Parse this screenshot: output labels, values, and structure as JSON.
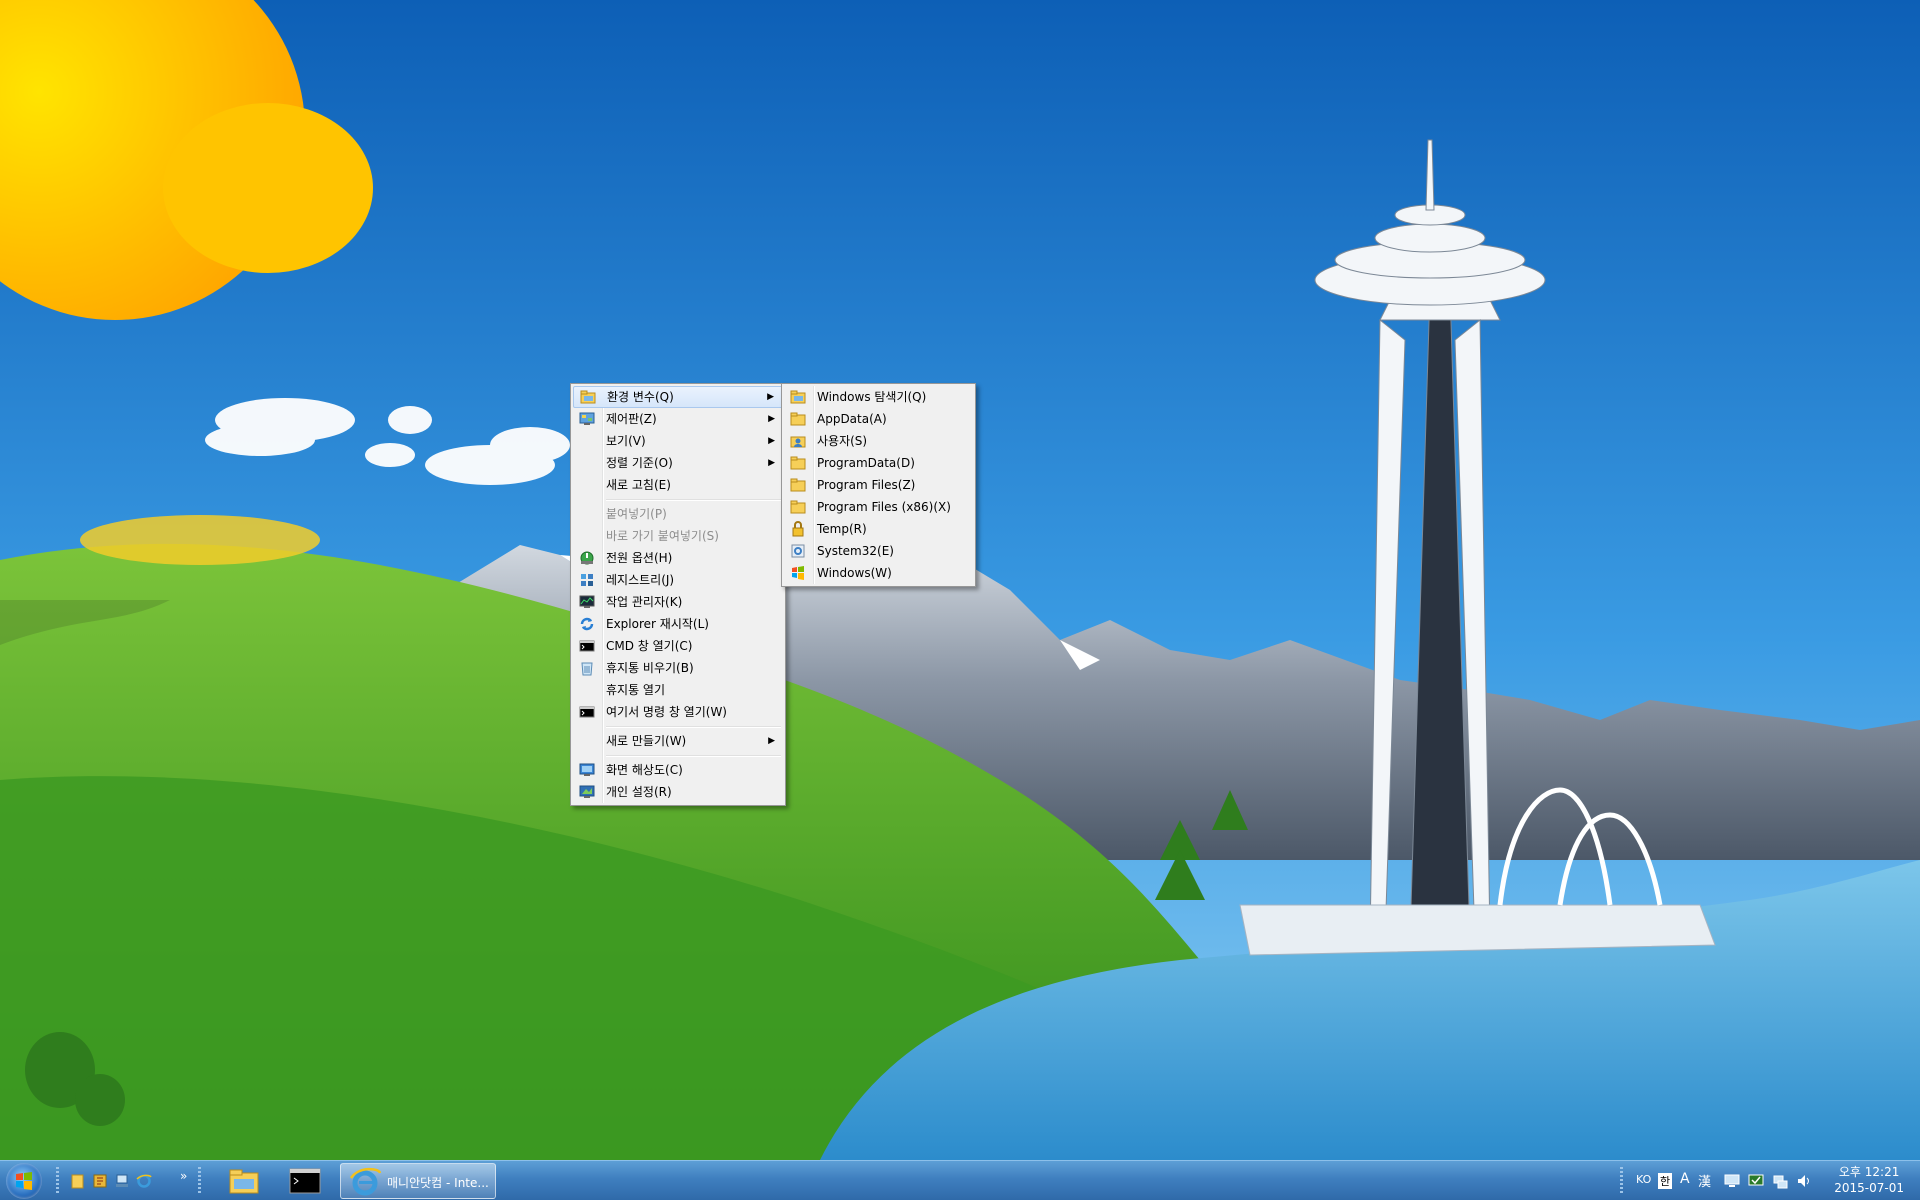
{
  "context_menu": {
    "items": [
      {
        "label": "환경 변수(Q)",
        "icon": "folder-tree-icon",
        "submenu": true,
        "highlight": true
      },
      {
        "label": "제어판(Z)",
        "icon": "control-panel-icon",
        "submenu": true
      },
      {
        "label": "보기(V)",
        "submenu": true
      },
      {
        "label": "정렬 기준(O)",
        "submenu": true
      },
      {
        "label": "새로 고침(E)"
      },
      {
        "label": "붙여넣기(P)",
        "disabled": true
      },
      {
        "label": "바로 가기 붙여넣기(S)",
        "disabled": true
      },
      {
        "label": "전원 옵션(H)",
        "icon": "power-options-icon"
      },
      {
        "label": "레지스트리(J)",
        "icon": "registry-icon"
      },
      {
        "label": "작업 관리자(K)",
        "icon": "task-manager-icon"
      },
      {
        "label": "Explorer 재시작(L)",
        "icon": "restart-icon"
      },
      {
        "label": "CMD 창 열기(C)",
        "icon": "cmd-icon"
      },
      {
        "label": "휴지통 비우기(B)",
        "icon": "recycle-bin-icon"
      },
      {
        "label": "휴지통 열기"
      },
      {
        "label": "여기서 명령 창 열기(W)",
        "icon": "cmd-icon"
      },
      {
        "label": "새로 만들기(W)",
        "submenu": true
      },
      {
        "label": "화면 해상도(C)",
        "icon": "screen-resolution-icon"
      },
      {
        "label": "개인 설정(R)",
        "icon": "personalize-icon"
      }
    ]
  },
  "submenu": {
    "items": [
      {
        "label": "Windows 탐색기(Q)",
        "icon": "explorer-icon"
      },
      {
        "label": "AppData(A)",
        "icon": "folder-icon"
      },
      {
        "label": "사용자(S)",
        "icon": "user-folder-icon"
      },
      {
        "label": "ProgramData(D)",
        "icon": "folder-icon"
      },
      {
        "label": "Program Files(Z)",
        "icon": "folder-icon"
      },
      {
        "label": "Program Files (x86)(X)",
        "icon": "folder-icon"
      },
      {
        "label": "Temp(R)",
        "icon": "lock-icon"
      },
      {
        "label": "System32(E)",
        "icon": "system-icon"
      },
      {
        "label": "Windows(W)",
        "icon": "windows-icon"
      }
    ]
  },
  "taskbar": {
    "chevron": "»",
    "active_window_label": "매니안닷컴 - Inte...",
    "tray_lang": "KO",
    "tray_ime": "한",
    "tray_font": "A",
    "tray_hanja": "漢",
    "clock_time": "오후 12:21",
    "clock_date": "2015-07-01"
  }
}
